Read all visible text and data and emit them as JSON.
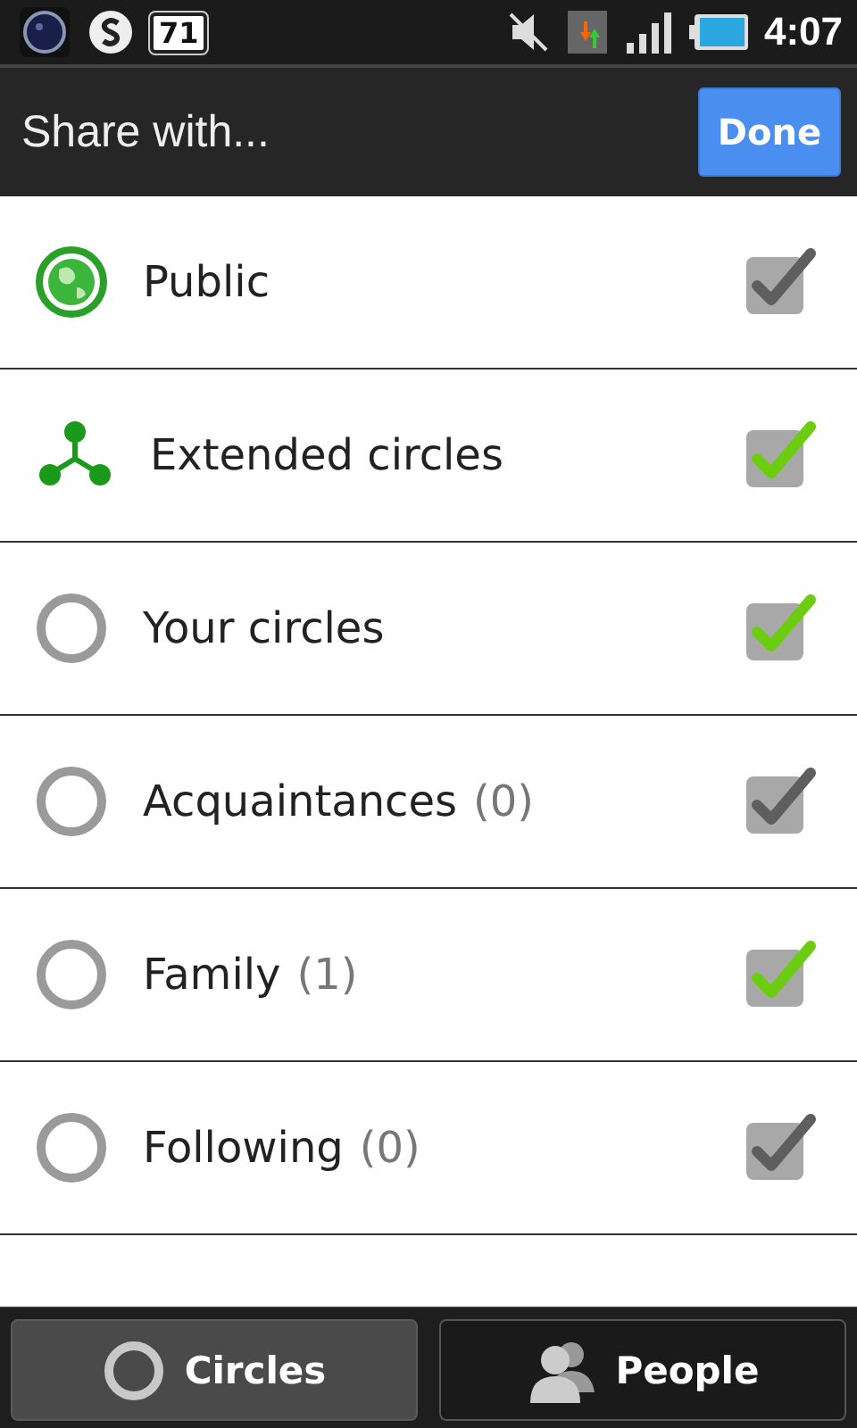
{
  "status_bar": {
    "battery_badge": "71",
    "time": "4:07"
  },
  "header": {
    "title": "Share with...",
    "done_button": "Done"
  },
  "circles": [
    {
      "kind": "globe",
      "name": "Public",
      "checked": true,
      "disabled": true
    },
    {
      "kind": "extended",
      "name": "Extended circles",
      "checked": true,
      "disabled": false
    },
    {
      "kind": "circle",
      "name": "Your circles",
      "checked": true,
      "disabled": false
    },
    {
      "kind": "circle",
      "name": "Acquaintances",
      "count": "(0)",
      "checked": true,
      "disabled": true
    },
    {
      "kind": "circle",
      "name": "Family",
      "count": "(1)",
      "checked": true,
      "disabled": false
    },
    {
      "kind": "circle",
      "name": "Following",
      "count": "(0)",
      "checked": true,
      "disabled": true
    }
  ],
  "tabs": [
    {
      "kind": "circles",
      "label": "Circles",
      "selected": true
    },
    {
      "kind": "people",
      "label": "People",
      "selected": false
    }
  ]
}
